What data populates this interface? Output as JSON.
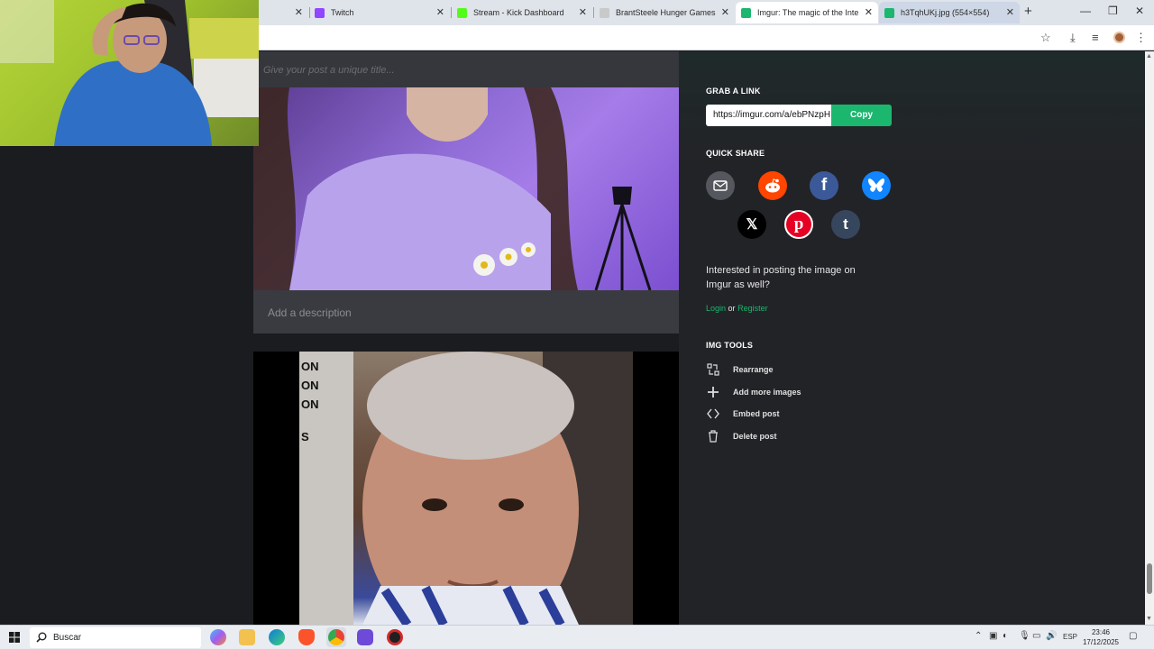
{
  "browser": {
    "tabs": [
      {
        "title": "Twitch",
        "active": false
      },
      {
        "title": "Stream - Kick Dashboard",
        "active": false
      },
      {
        "title": "BrantSteele Hunger Games Sim",
        "active": false
      },
      {
        "title": "Imgur: The magic of the Intern",
        "active": true
      },
      {
        "title": "h3TqhUKj.jpg (554×554)",
        "active": false
      }
    ],
    "colors": {
      "twitch": "#9146ff",
      "kick": "#53fc18",
      "imgur": "#1bb76e"
    }
  },
  "post": {
    "title_placeholder": "Give your post a unique title...",
    "description_placeholder": "Add a description"
  },
  "sidebar": {
    "grab_link_heading": "GRAB A LINK",
    "link_url": "https://imgur.com/a/ebPNzpH",
    "copy_label": "Copy",
    "quick_share_heading": "QUICK SHARE",
    "share_targets": [
      "email",
      "reddit",
      "facebook",
      "bluesky",
      "x",
      "pinterest",
      "tumblr"
    ],
    "promo_text": "Interested in posting the image on Imgur as well?",
    "login_label": "Login",
    "or_label": "or",
    "register_label": "Register",
    "img_tools_heading": "IMG TOOLS",
    "tools": [
      {
        "label": "Rearrange",
        "icon": "rearrange-icon"
      },
      {
        "label": "Add more images",
        "icon": "plus-icon"
      },
      {
        "label": "Embed post",
        "icon": "code-icon"
      },
      {
        "label": "Delete post",
        "icon": "trash-icon"
      }
    ]
  },
  "image2_overlay": {
    "lines": [
      "ON",
      "ON",
      "ON",
      "S"
    ]
  },
  "taskbar": {
    "search_label": "Buscar",
    "language": "ESP",
    "time": "23:46",
    "date": "17/12/2025"
  }
}
